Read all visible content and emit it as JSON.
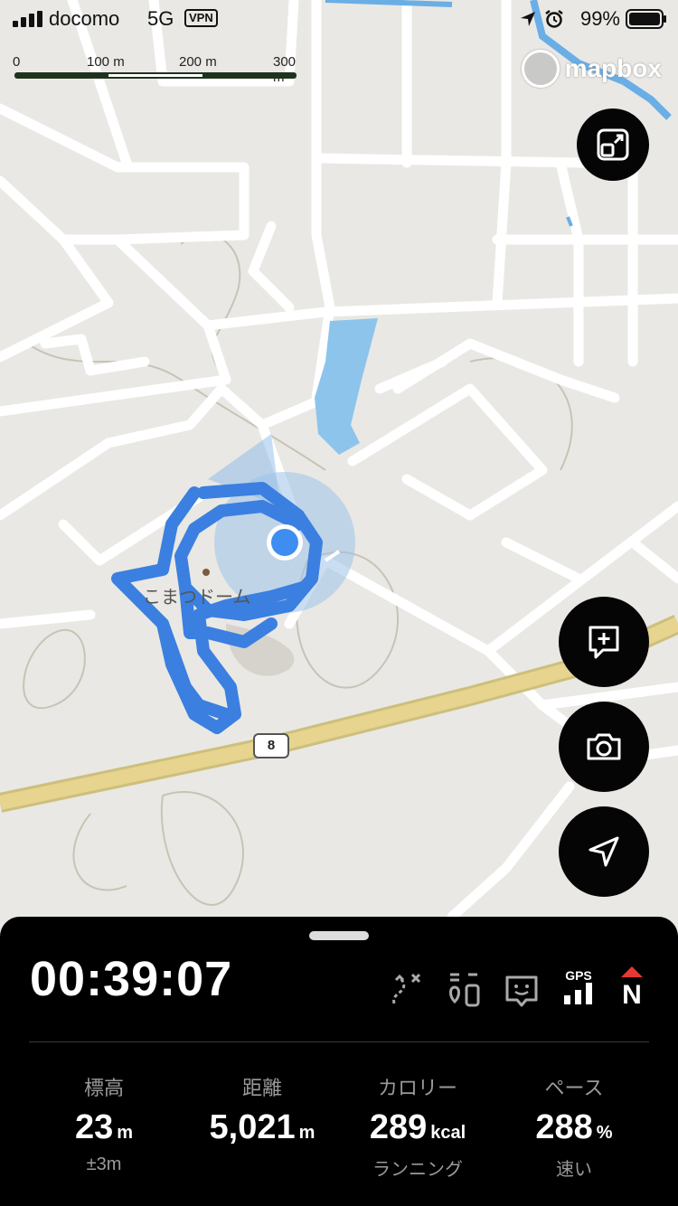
{
  "status_bar": {
    "carrier": "docomo",
    "network": "5G",
    "vpn": "VPN",
    "battery": "99%"
  },
  "scale_bar": {
    "ticks": [
      "0",
      "100 m",
      "200 m",
      "300 m"
    ]
  },
  "map": {
    "attribution": "mapbox",
    "road_number": "8",
    "poi_label": "こまつドーム",
    "route_color": "#3b7fe0",
    "location_color": "#3d8ef0"
  },
  "buttons": {
    "expand": "expand-icon",
    "add_note": "add-note-icon",
    "camera": "camera-icon",
    "navigate": "location-arrow-icon"
  },
  "panel": {
    "timer": "00:39:07",
    "icons": [
      "route-off-icon",
      "waypoints-icon",
      "feedback-icon",
      "gps-signal-icon",
      "north-compass-icon"
    ],
    "gps_label": "GPS",
    "compass_label": "N",
    "stats": [
      {
        "label": "標高",
        "value": "23",
        "unit": "m",
        "sub": "±3m"
      },
      {
        "label": "距離",
        "value": "5,021",
        "unit": "m",
        "sub": ""
      },
      {
        "label": "カロリー",
        "value": "289",
        "unit": "kcal",
        "sub": "ランニング"
      },
      {
        "label": "ペース",
        "value": "288",
        "unit": "%",
        "sub": "速い"
      }
    ]
  }
}
